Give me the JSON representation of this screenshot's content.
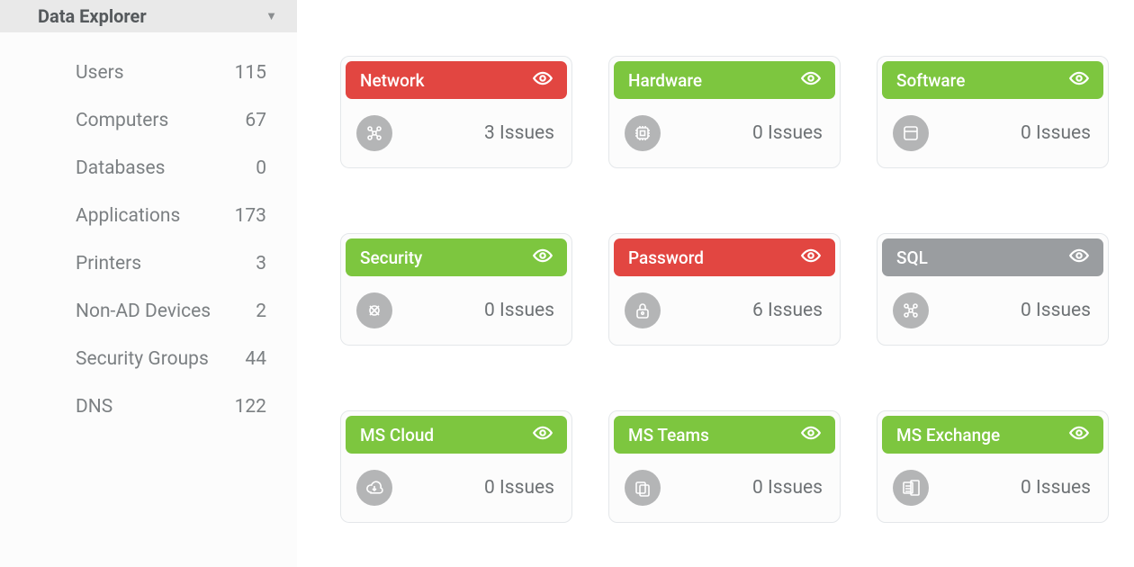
{
  "sidebar": {
    "title": "Data Explorer",
    "items": [
      {
        "label": "Users",
        "count": "115"
      },
      {
        "label": "Computers",
        "count": "67"
      },
      {
        "label": "Databases",
        "count": "0"
      },
      {
        "label": "Applications",
        "count": "173"
      },
      {
        "label": "Printers",
        "count": "3"
      },
      {
        "label": "Non-AD Devices",
        "count": "2"
      },
      {
        "label": "Security Groups",
        "count": "44"
      },
      {
        "label": "DNS",
        "count": "122"
      }
    ]
  },
  "cards": [
    {
      "title": "Network",
      "issues": "3 Issues",
      "status": "red",
      "icon": "network-icon"
    },
    {
      "title": "Hardware",
      "issues": "0 Issues",
      "status": "green",
      "icon": "chip-icon"
    },
    {
      "title": "Software",
      "issues": "0 Issues",
      "status": "green",
      "icon": "window-icon"
    },
    {
      "title": "Security",
      "issues": "0 Issues",
      "status": "green",
      "icon": "bug-icon"
    },
    {
      "title": "Password",
      "issues": "6 Issues",
      "status": "red",
      "icon": "lock-icon"
    },
    {
      "title": "SQL",
      "issues": "0 Issues",
      "status": "gray",
      "icon": "network-icon"
    },
    {
      "title": "MS Cloud",
      "issues": "0 Issues",
      "status": "green",
      "icon": "cloud-icon"
    },
    {
      "title": "MS Teams",
      "issues": "0 Issues",
      "status": "green",
      "icon": "teams-icon"
    },
    {
      "title": "MS Exchange",
      "issues": "0 Issues",
      "status": "green",
      "icon": "exchange-icon"
    }
  ]
}
